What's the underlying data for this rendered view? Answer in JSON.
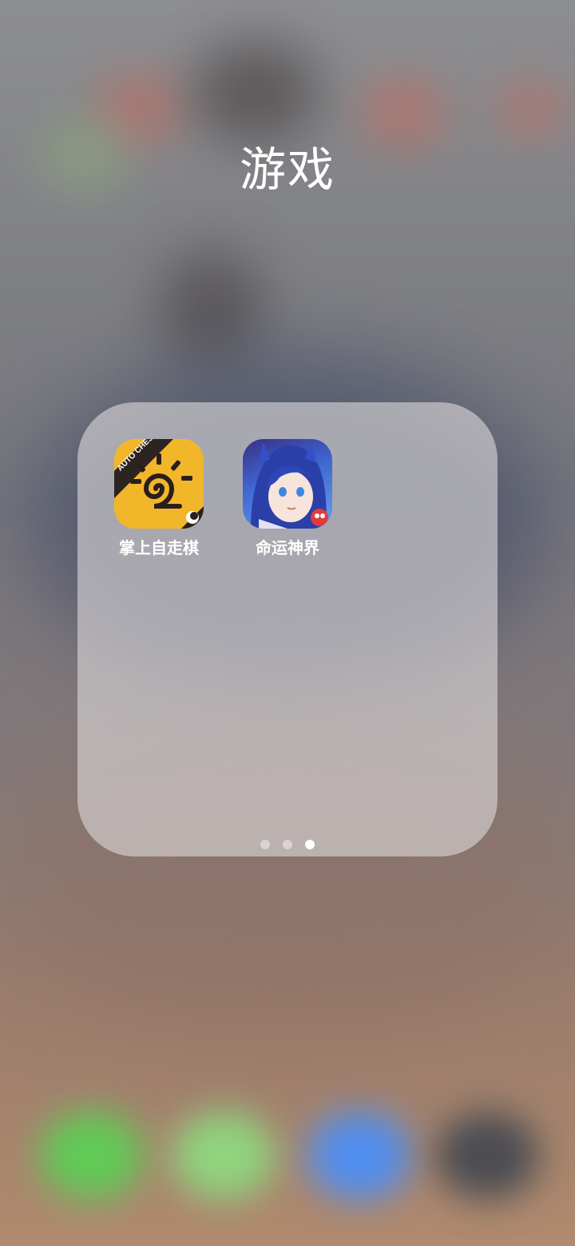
{
  "folder": {
    "title": "游戏",
    "apps": [
      {
        "label": "掌上自走棋",
        "icon": "auto-chess-icon",
        "badge_text": "AUTO CHESS"
      },
      {
        "label": "命运神界",
        "icon": "destiny-realm-icon"
      }
    ],
    "pagination": {
      "current": 3,
      "total": 3
    }
  },
  "dock": {
    "icons": [
      "phone-icon",
      "messages-icon",
      "safari-icon",
      "camera-icon"
    ]
  }
}
